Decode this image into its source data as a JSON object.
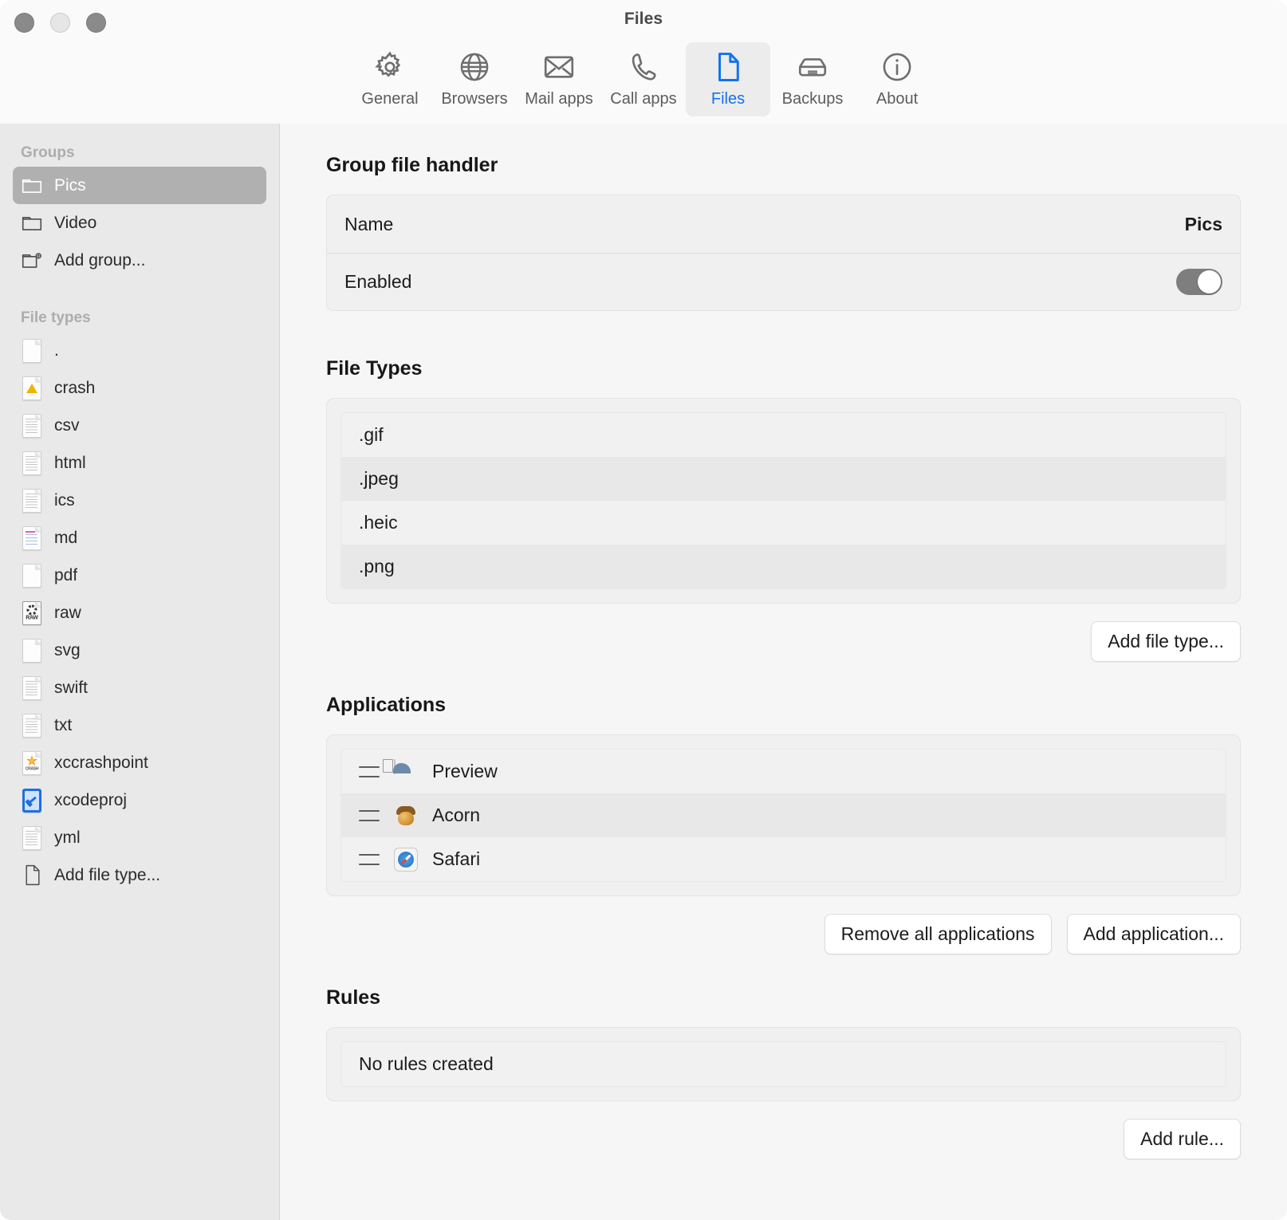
{
  "window": {
    "title": "Files",
    "traffic_lights": [
      "close",
      "minimize",
      "zoom"
    ]
  },
  "toolbar": {
    "items": [
      {
        "label": "General",
        "icon": "gear-icon",
        "selected": false
      },
      {
        "label": "Browsers",
        "icon": "globe-icon",
        "selected": false
      },
      {
        "label": "Mail apps",
        "icon": "envelope-icon",
        "selected": false
      },
      {
        "label": "Call apps",
        "icon": "phone-icon",
        "selected": false
      },
      {
        "label": "Files",
        "icon": "document-icon",
        "selected": true
      },
      {
        "label": "Backups",
        "icon": "drive-icon",
        "selected": false
      },
      {
        "label": "About",
        "icon": "info-icon",
        "selected": false
      }
    ],
    "accent_color": "#1273ee"
  },
  "sidebar": {
    "groups_header": "Groups",
    "groups": [
      {
        "label": "Pics",
        "icon": "folder-icon",
        "selected": true
      },
      {
        "label": "Video",
        "icon": "folder-icon",
        "selected": false
      },
      {
        "label": "Add group...",
        "icon": "folder-add-icon",
        "selected": false
      }
    ],
    "file_types_header": "File types",
    "file_types": [
      {
        "label": ".",
        "icon": "document-plain-icon"
      },
      {
        "label": "crash",
        "icon": "document-crash-icon"
      },
      {
        "label": "csv",
        "icon": "document-text-icon"
      },
      {
        "label": "html",
        "icon": "document-text-icon"
      },
      {
        "label": "ics",
        "icon": "document-text-icon"
      },
      {
        "label": "md",
        "icon": "document-markdown-icon"
      },
      {
        "label": "pdf",
        "icon": "document-plain-icon"
      },
      {
        "label": "raw",
        "icon": "document-raw-icon",
        "badge": "RAW"
      },
      {
        "label": "svg",
        "icon": "document-plain-icon"
      },
      {
        "label": "swift",
        "icon": "document-text-icon"
      },
      {
        "label": "txt",
        "icon": "document-text-icon"
      },
      {
        "label": "xccrashpoint",
        "icon": "document-xccrash-icon",
        "badge": "CRASH"
      },
      {
        "label": "xcodeproj",
        "icon": "xcode-project-icon"
      },
      {
        "label": "yml",
        "icon": "document-text-icon"
      }
    ],
    "add_file_type": {
      "label": "Add file type...",
      "icon": "document-add-icon"
    }
  },
  "main": {
    "group_file_handler": {
      "title": "Group file handler",
      "rows": [
        {
          "key": "Name",
          "value": "Pics",
          "type": "text"
        },
        {
          "key": "Enabled",
          "value": "on",
          "type": "toggle"
        }
      ]
    },
    "file_types": {
      "title": "File Types",
      "items": [
        ".gif",
        ".jpeg",
        ".heic",
        ".png"
      ],
      "add_button": "Add file type..."
    },
    "applications": {
      "title": "Applications",
      "items": [
        {
          "name": "Preview",
          "icon": "preview-app-icon"
        },
        {
          "name": "Acorn",
          "icon": "acorn-app-icon"
        },
        {
          "name": "Safari",
          "icon": "safari-app-icon"
        }
      ],
      "remove_all_button": "Remove all applications",
      "add_button": "Add application..."
    },
    "rules": {
      "title": "Rules",
      "empty_text": "No rules created",
      "add_button": "Add rule..."
    }
  }
}
